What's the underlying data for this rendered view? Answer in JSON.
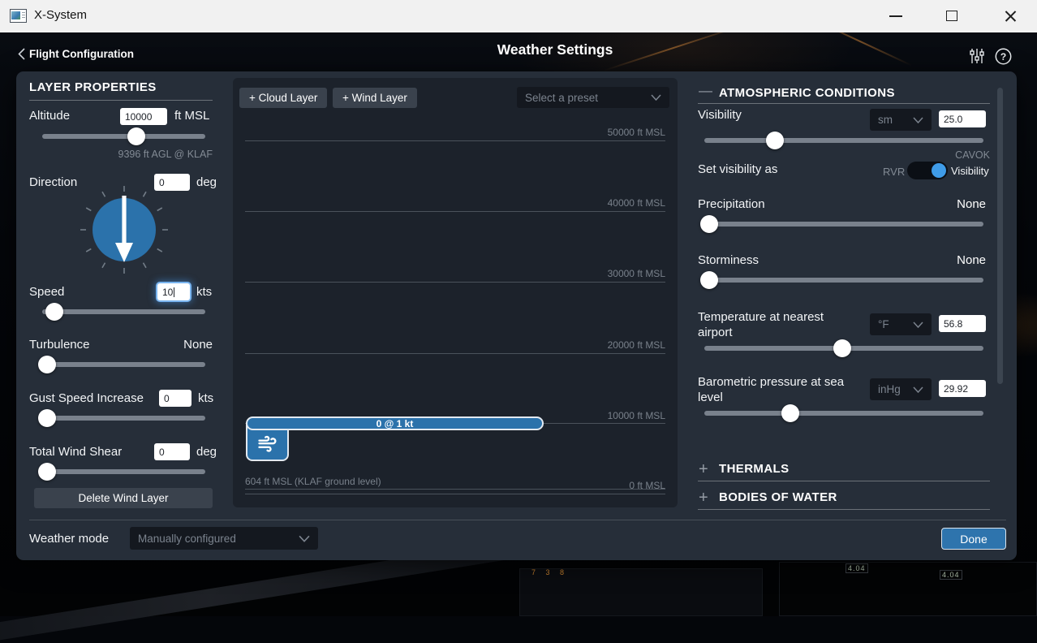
{
  "titlebar": {
    "app_title": "X-System"
  },
  "header": {
    "back_label": "Flight Configuration",
    "title": "Weather Settings"
  },
  "layer_properties": {
    "title": "LAYER PROPERTIES",
    "altitude": {
      "label": "Altitude",
      "value": "10000",
      "unit": "ft MSL",
      "note": "9396 ft AGL @ KLAF",
      "thumb": "57.7%"
    },
    "direction": {
      "label": "Direction",
      "value": "0",
      "unit": "deg"
    },
    "speed": {
      "label": "Speed",
      "value": "10",
      "unit": "kts",
      "thumb": "7.5%"
    },
    "turbulence": {
      "label": "Turbulence",
      "level": "None",
      "thumb": "3%"
    },
    "gust": {
      "label": "Gust Speed Increase",
      "value": "0",
      "unit": "kts",
      "thumb": "3%"
    },
    "wind_shear": {
      "label": "Total Wind Shear",
      "value": "0",
      "unit": "deg",
      "thumb": "3%"
    },
    "delete_button": "Delete Wind Layer"
  },
  "layers_panel": {
    "add_cloud_button": "+ Cloud Layer",
    "add_wind_button": "+ Wind Layer",
    "preset_placeholder": "Select a preset",
    "altitude_labels": {
      "l50": "50000 ft MSL",
      "l40": "40000 ft MSL",
      "l30": "30000 ft MSL",
      "l20": "20000 ft MSL",
      "l10": "10000 ft MSL",
      "l0": "0 ft MSL"
    },
    "wind_layer_pill": "0 @ 1 kt",
    "ground_label": "604 ft MSL (KLAF ground level)"
  },
  "atmospheric": {
    "title": "ATMOSPHERIC CONDITIONS",
    "collapse_glyph": "—",
    "visibility": {
      "label": "Visibility",
      "unit": "sm",
      "value": "25.0",
      "thumb": "25.3%",
      "cavok": "CAVOK"
    },
    "visibility_mode": {
      "label": "Set visibility as",
      "off_label": "RVR",
      "on_label": "Visibility"
    },
    "precipitation": {
      "label": "Precipitation",
      "level": "None",
      "thumb": "1.7%"
    },
    "storminess": {
      "label": "Storminess",
      "level": "None",
      "thumb": "1.7%"
    },
    "temperature": {
      "label": "Temperature at nearest airport",
      "unit": "°F",
      "value": "56.8",
      "thumb": "49.4%"
    },
    "pressure": {
      "label": "Barometric pressure at sea level",
      "unit": "inHg",
      "value": "29.92",
      "thumb": "30.8%"
    },
    "thermals": {
      "title": "THERMALS",
      "expand_glyph": "+"
    },
    "bodies_of_water": {
      "title": "BODIES OF WATER",
      "expand_glyph": "+"
    }
  },
  "footer": {
    "mode_label": "Weather mode",
    "mode_value": "Manually configured",
    "done_button": "Done"
  },
  "background": {
    "readout_left": "4.04",
    "readout_right": "4.04",
    "digits": "7 3 8"
  },
  "colors": {
    "accent": "#2e74ad",
    "toggle_on": "#3f9ce8",
    "panel": "#262e39",
    "subpanel": "#1c222b",
    "muted_text": "#828a94"
  }
}
